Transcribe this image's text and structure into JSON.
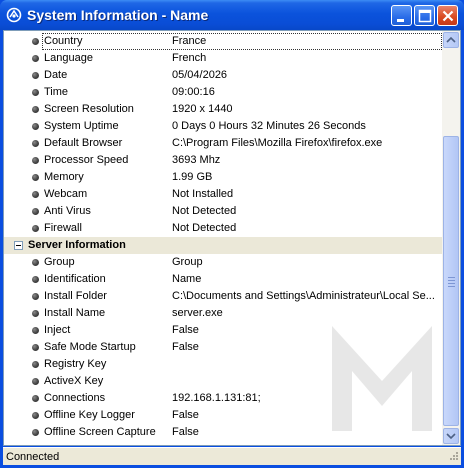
{
  "window": {
    "title": "System Information - Name",
    "icon": "app-logo-icon"
  },
  "rows": [
    {
      "type": "item",
      "label": "Country",
      "value": "France",
      "selected": true
    },
    {
      "type": "item",
      "label": "Language",
      "value": "French"
    },
    {
      "type": "item",
      "label": "Date",
      "value": "05/04/2026"
    },
    {
      "type": "item",
      "label": "Time",
      "value": "09:00:16"
    },
    {
      "type": "item",
      "label": "Screen Resolution",
      "value": "1920 x 1440"
    },
    {
      "type": "item",
      "label": "System Uptime",
      "value": "0 Days 0 Hours 32 Minutes 26 Seconds"
    },
    {
      "type": "item",
      "label": "Default Browser",
      "value": "C:\\Program Files\\Mozilla Firefox\\firefox.exe"
    },
    {
      "type": "item",
      "label": "Processor Speed",
      "value": "3693 Mhz"
    },
    {
      "type": "item",
      "label": "Memory",
      "value": "1.99 GB"
    },
    {
      "type": "item",
      "label": "Webcam",
      "value": "Not Installed"
    },
    {
      "type": "item",
      "label": "Anti Virus",
      "value": "Not Detected"
    },
    {
      "type": "item",
      "label": "Firewall",
      "value": "Not Detected"
    },
    {
      "type": "group",
      "label": "Server Information"
    },
    {
      "type": "item",
      "label": "Group",
      "value": "Group"
    },
    {
      "type": "item",
      "label": "Identification",
      "value": "Name"
    },
    {
      "type": "item",
      "label": "Install Folder",
      "value": "C:\\Documents and Settings\\Administrateur\\Local Se..."
    },
    {
      "type": "item",
      "label": "Install Name",
      "value": "server.exe"
    },
    {
      "type": "item",
      "label": "Inject",
      "value": "False"
    },
    {
      "type": "item",
      "label": "Safe Mode Startup",
      "value": "False"
    },
    {
      "type": "item",
      "label": "Registry Key",
      "value": ""
    },
    {
      "type": "item",
      "label": "ActiveX Key",
      "value": ""
    },
    {
      "type": "item",
      "label": "Connections",
      "value": "192.168.1.131:81;"
    },
    {
      "type": "item",
      "label": "Offline Key Logger",
      "value": "False"
    },
    {
      "type": "item",
      "label": "Offline Screen Capture",
      "value": "False"
    }
  ],
  "status": {
    "text": "Connected"
  },
  "colors": {
    "titlebar": "#0a4ee0",
    "group_row_bg": "#ebe8d8",
    "status_bg": "#ece9d8"
  }
}
